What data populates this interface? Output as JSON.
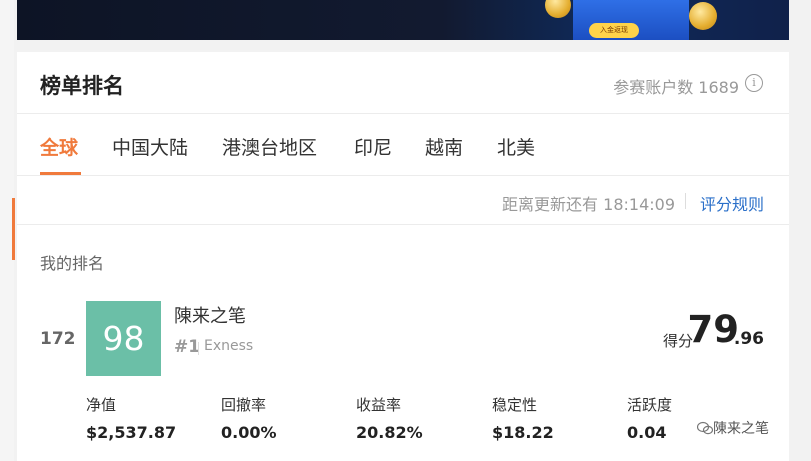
{
  "banner": {
    "cta": "入金返现"
  },
  "leaderboard": {
    "title": "榜单排名",
    "participants_label": "参赛账户数 1689",
    "tabs": [
      {
        "label": "全球",
        "active": true
      },
      {
        "label": "中国大陆",
        "active": false
      },
      {
        "label": "港澳台地区",
        "active": false
      },
      {
        "label": "印尼",
        "active": false
      },
      {
        "label": "越南",
        "active": false
      },
      {
        "label": "北美",
        "active": false
      }
    ],
    "countdown": "距离更新还有 18:14:09",
    "rules_link": "评分规则"
  },
  "my_ranking": {
    "label": "我的排名",
    "rank": "172",
    "avatar_text": "98",
    "name": "陳来之笔",
    "sub_rank": "#1",
    "broker": "Exness",
    "score_label": "得分",
    "score_int": "79",
    "score_dec": ".96",
    "stats": [
      {
        "label": "净值",
        "value": "$2,537.87"
      },
      {
        "label": "回撤率",
        "value": "0.00%"
      },
      {
        "label": "收益率",
        "value": "20.82%"
      },
      {
        "label": "稳定性",
        "value": "$18.22"
      },
      {
        "label": "活跃度",
        "value": "0.04"
      }
    ]
  },
  "watermark": "陳来之笔",
  "colors": {
    "accent": "#f07a3c",
    "link": "#2a6fc9",
    "avatar_bg": "#6bbfa7"
  }
}
